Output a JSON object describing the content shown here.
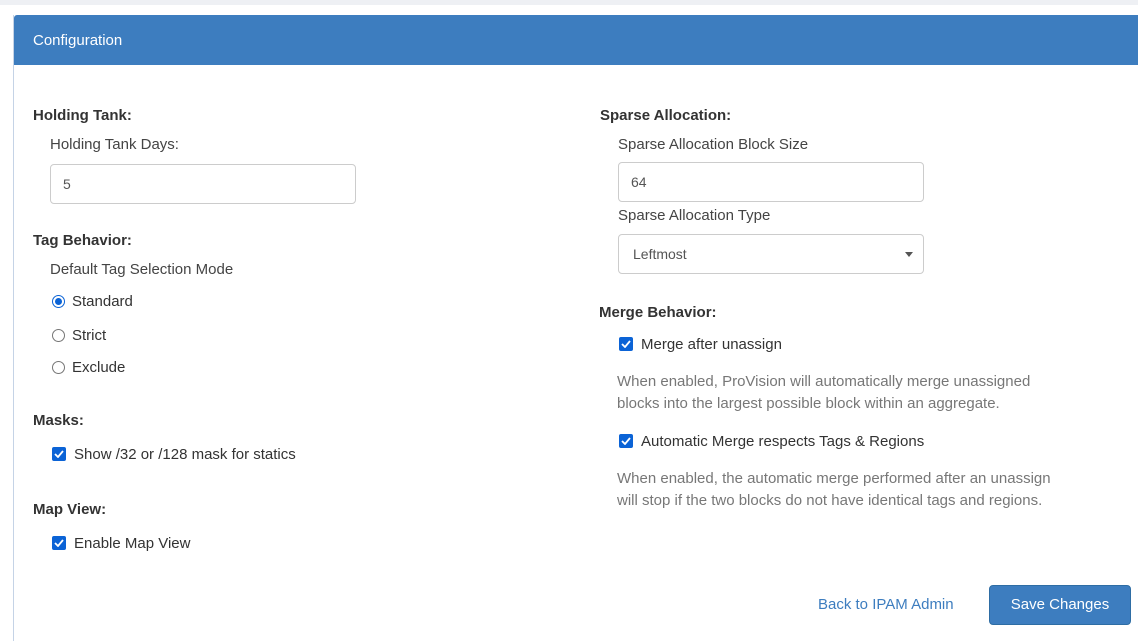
{
  "panel": {
    "title": "Configuration"
  },
  "holding_tank": {
    "heading": "Holding Tank:",
    "days_label": "Holding Tank Days:",
    "days_value": "5"
  },
  "tag_behavior": {
    "heading": "Tag Behavior:",
    "mode_label": "Default Tag Selection Mode",
    "options": [
      {
        "label": "Standard",
        "selected": true
      },
      {
        "label": "Strict",
        "selected": false
      },
      {
        "label": "Exclude",
        "selected": false
      }
    ]
  },
  "masks": {
    "heading": "Masks:",
    "show_mask_label": "Show /32 or /128 mask for statics",
    "show_mask_checked": true
  },
  "map_view": {
    "heading": "Map View:",
    "enable_label": "Enable Map View",
    "enable_checked": true
  },
  "sparse_allocation": {
    "heading": "Sparse Allocation:",
    "block_size_label": "Sparse Allocation Block Size",
    "block_size_value": "64",
    "type_label": "Sparse Allocation Type",
    "type_value": "Leftmost"
  },
  "merge_behavior": {
    "heading": "Merge Behavior:",
    "merge_after_unassign_label": "Merge after unassign",
    "merge_after_unassign_checked": true,
    "merge_after_unassign_help_1": "When enabled, ProVision will automatically merge unassigned",
    "merge_after_unassign_help_2": "blocks into the largest possible block within an aggregate.",
    "auto_merge_tags_label": "Automatic Merge respects Tags & Regions",
    "auto_merge_tags_checked": true,
    "auto_merge_tags_help_1": "When enabled, the automatic merge performed after an unassign",
    "auto_merge_tags_help_2": "will stop if the two blocks do not have identical tags and regions."
  },
  "footer": {
    "back_link": "Back to IPAM Admin",
    "save_label": "Save Changes"
  },
  "colors": {
    "header_bg": "#3d7dbf",
    "accent": "#0b63d6",
    "link": "#3d7dbf"
  },
  "icons": {
    "select_caret": "caret-down-icon",
    "radio": "radio-icon",
    "checkbox": "checkbox-checked-icon"
  }
}
